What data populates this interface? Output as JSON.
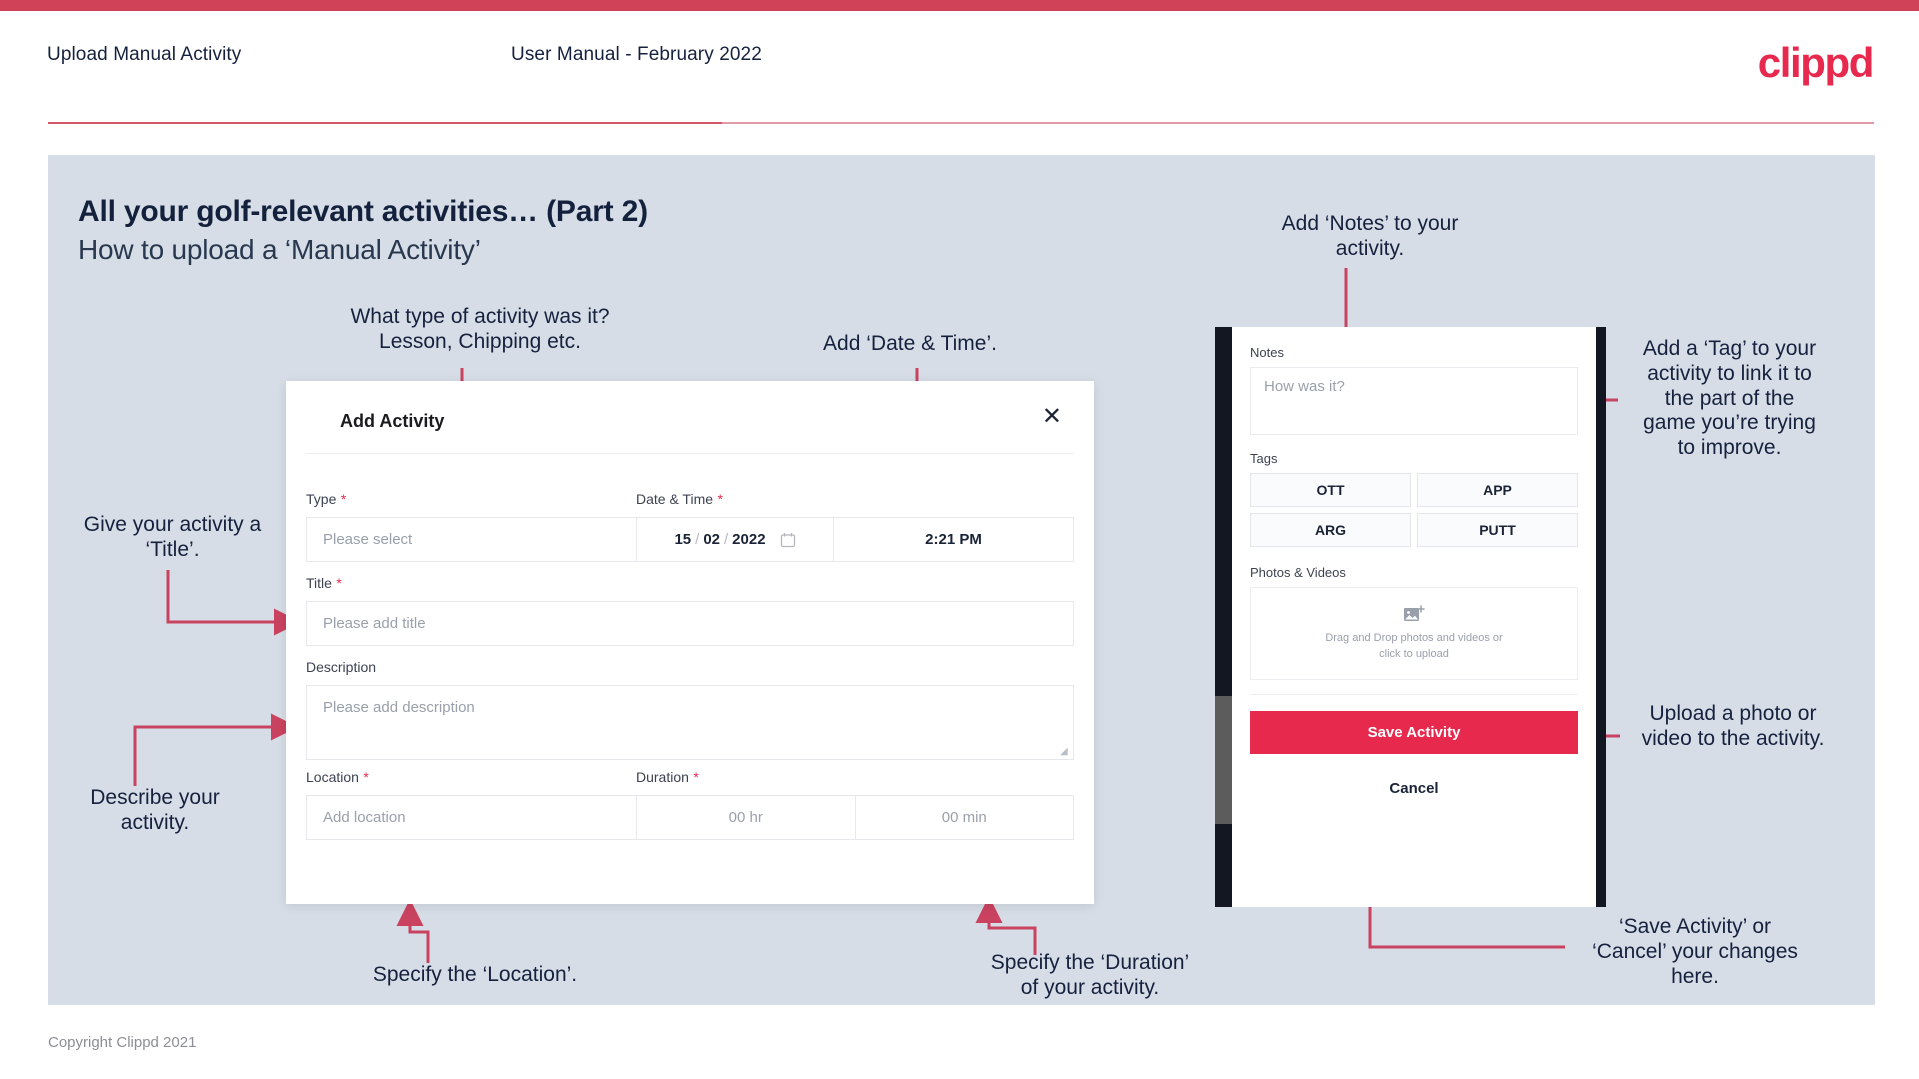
{
  "header": {
    "left_title": "Upload Manual Activity",
    "center_title": "User Manual - February 2022",
    "logo": "clippd"
  },
  "slide": {
    "title": "All your golf-relevant activities… (Part 2)",
    "subtitle": "How to upload a ‘Manual Activity’"
  },
  "annotations": {
    "type": "What type of activity was it?\nLesson, Chipping etc.",
    "datetime": "Add ‘Date & Time’.",
    "title": "Give your activity a\n‘Title’.",
    "description": "Describe your\nactivity.",
    "location": "Specify the ‘Location’.",
    "duration": "Specify the ‘Duration’\nof your activity.",
    "notes": "Add ‘Notes’ to your\nactivity.",
    "tags": "Add a ‘Tag’ to your\nactivity to link it to\nthe part of the\ngame you’re trying\nto improve.",
    "upload": "Upload a photo or\nvideo to the activity.",
    "save_cancel": "‘Save Activity’ or\n‘Cancel’ your changes\nhere."
  },
  "dialog": {
    "title": "Add Activity",
    "close_icon": "close-icon",
    "fields": {
      "type": {
        "label": "Type",
        "required": "*",
        "placeholder": "Please select"
      },
      "datetime": {
        "label": "Date & Time",
        "required": "*",
        "day": "15",
        "month": "02",
        "year": "2022",
        "sep": "/",
        "time": "2:21 PM"
      },
      "title": {
        "label": "Title",
        "required": "*",
        "placeholder": "Please add title"
      },
      "description": {
        "label": "Description",
        "required": "",
        "placeholder": "Please add description"
      },
      "location": {
        "label": "Location",
        "required": "*",
        "placeholder": "Add location"
      },
      "duration": {
        "label": "Duration",
        "required": "*",
        "hours": "00 hr",
        "minutes": "00 min"
      }
    }
  },
  "phone": {
    "notes": {
      "label": "Notes",
      "placeholder": "How was it?"
    },
    "tags": {
      "label": "Tags",
      "options": [
        "OTT",
        "APP",
        "ARG",
        "PUTT"
      ]
    },
    "photos": {
      "label": "Photos & Videos",
      "drop_text": "Drag and Drop photos and videos or\nclick to upload"
    },
    "save_label": "Save Activity",
    "cancel_label": "Cancel"
  },
  "footer": {
    "copyright": "Copyright Clippd 2021"
  },
  "colors": {
    "brand_pink": "#e8294e",
    "top_bar": "#cf4257",
    "slide_bg": "#d6dde6",
    "text_dark": "#16213e",
    "arrow": "#c94360"
  }
}
